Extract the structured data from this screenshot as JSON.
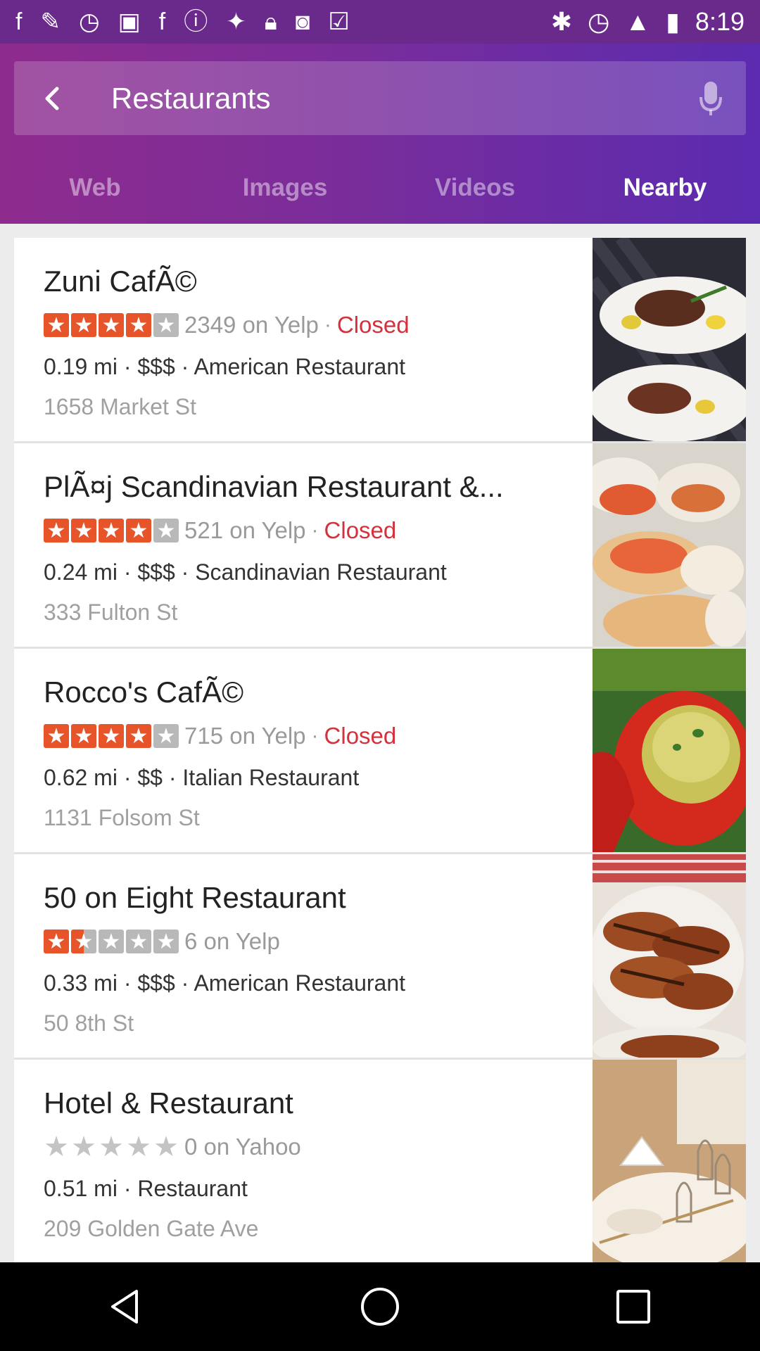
{
  "status_bar": {
    "time": "8:19"
  },
  "search": {
    "query": "Restaurants"
  },
  "tabs": [
    {
      "label": "Web"
    },
    {
      "label": "Images"
    },
    {
      "label": "Videos"
    },
    {
      "label": "Nearby"
    }
  ],
  "results": [
    {
      "name": "Zuni CafÃ©",
      "rating": 4,
      "reviews": "2349 on Yelp",
      "status": "Closed",
      "distance": "0.19 mi",
      "price": "$$$",
      "category": "American Restaurant",
      "address": "1658 Market St"
    },
    {
      "name": "PlÃ¤j Scandinavian Restaurant &...",
      "rating": 4,
      "reviews": "521 on Yelp",
      "status": "Closed",
      "distance": "0.24 mi",
      "price": "$$$",
      "category": "Scandinavian Restaurant",
      "address": "333 Fulton St"
    },
    {
      "name": "Rocco's CafÃ©",
      "rating": 4,
      "reviews": "715 on Yelp",
      "status": "Closed",
      "distance": "0.62 mi",
      "price": "$$",
      "category": "Italian Restaurant",
      "address": "1131 Folsom St"
    },
    {
      "name": "50 on Eight Restaurant",
      "rating": 1.5,
      "reviews": "6 on Yelp",
      "status": "",
      "distance": "0.33 mi",
      "price": "$$$",
      "category": "American Restaurant",
      "address": "50 8th St"
    },
    {
      "name": "Hotel & Restaurant",
      "rating": 0,
      "reviews": "0 on Yahoo",
      "status": "",
      "distance": "0.51 mi",
      "price": "",
      "category": "Restaurant",
      "address": "209 Golden Gate Ave"
    }
  ],
  "colors": {
    "header_start": "#8e2c8e",
    "header_end": "#5b2bb0",
    "star_full": "#e8542a",
    "closed": "#d3323d"
  },
  "icons": [
    "back-arrow-icon",
    "microphone-icon",
    "nav-back-icon",
    "nav-home-icon",
    "nav-recents-icon"
  ]
}
